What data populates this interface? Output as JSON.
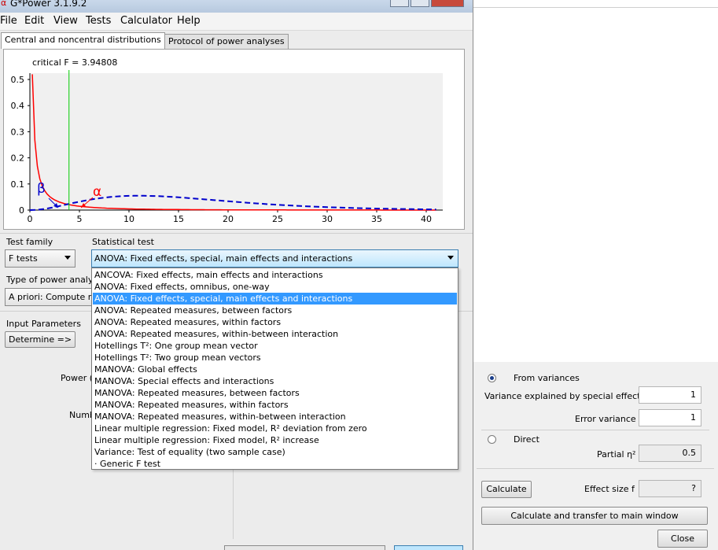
{
  "main": {
    "title": "G*Power 3.1.9.2",
    "menu": [
      "File",
      "Edit",
      "View",
      "Tests",
      "Calculator",
      "Help"
    ],
    "tabs": [
      "Central and noncentral distributions",
      "Protocol of power analyses"
    ],
    "plot": {
      "critical_label": "critical F = 3.94808",
      "critical_value": 3.94808,
      "beta_symbol": "β",
      "alpha_symbol": "α",
      "x_ticks": [
        "0",
        "5",
        "10",
        "15",
        "20",
        "25",
        "30",
        "35",
        "40"
      ],
      "y_ticks": [
        "0",
        "0.1",
        "0.2",
        "0.3",
        "0.4",
        "0.5"
      ],
      "central_color": "#ff0000",
      "noncentral_color": "#0000cc",
      "critical_color": "#00cc00"
    },
    "test_family_label": "Test family",
    "test_family_value": "F tests",
    "statistical_test_label": "Statistical test",
    "statistical_test_value": "ANOVA: Fixed effects, special, main effects and interactions",
    "type_of_power_label": "Type of power analy",
    "type_of_power_value": "A priori: Compute r",
    "input_parameters_label": "Input Parameters",
    "determine_button": "Determine =>",
    "power_label_partial": "Power (",
    "numb_label_partial": "Numb",
    "test_options": [
      "ANCOVA: Fixed effects, main effects and interactions",
      "ANOVA: Fixed effects, omnibus, one-way",
      "ANOVA: Fixed effects, special, main effects and interactions",
      "ANOVA: Repeated measures, between factors",
      "ANOVA: Repeated measures, within factors",
      "ANOVA: Repeated measures, within-between interaction",
      "Hotellings T²: One group mean vector",
      "Hotellings T²: Two group mean vectors",
      "MANOVA: Global effects",
      "MANOVA: Special effects and interactions",
      "MANOVA: Repeated measures, between factors",
      "MANOVA: Repeated measures, within factors",
      "MANOVA: Repeated measures, within-between interaction",
      "Linear multiple regression: Fixed model, R² deviation from zero",
      "Linear multiple regression: Fixed model, R² increase",
      "Variance: Test of equality (two sample case)",
      "· Generic F test"
    ],
    "selected_index": 2
  },
  "effect_panel": {
    "from_variances_label": "From variances",
    "variance_explained_label": "Variance explained by special effect",
    "variance_explained_value": "1",
    "error_variance_label": "Error variance",
    "error_variance_value": "1",
    "direct_label": "Direct",
    "partial_eta_label": "Partial η²",
    "partial_eta_value": "0.5",
    "calculate_button": "Calculate",
    "effect_size_label": "Effect size f",
    "effect_size_value": "?",
    "calc_transfer_button": "Calculate and transfer to main window",
    "close_button": "Close"
  }
}
